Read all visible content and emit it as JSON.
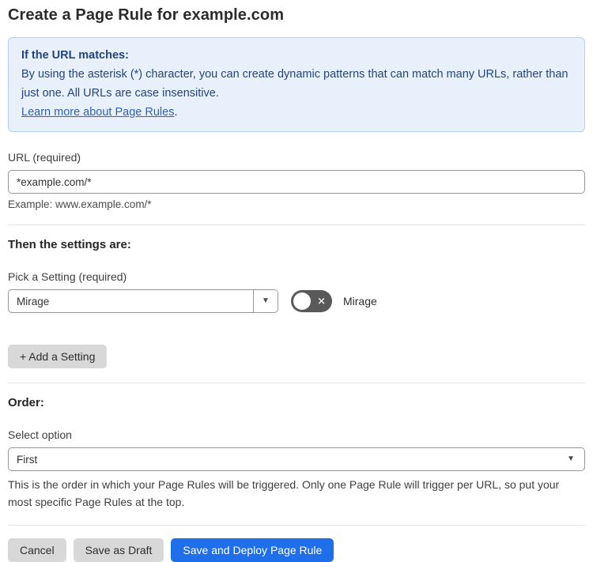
{
  "page": {
    "title": "Create a Page Rule for example.com"
  },
  "info_box": {
    "heading": "If the URL matches:",
    "body": "By using the asterisk (*) character, you can create dynamic patterns that can match many URLs, rather than just one. All URLs are case insensitive.",
    "link_label": "Learn more about Page Rules",
    "link_suffix": "."
  },
  "url_field": {
    "label": "URL (required)",
    "value": "*example.com/*",
    "helper": "Example: www.example.com/*"
  },
  "settings_section": {
    "heading": "Then the settings are:",
    "picker_label": "Pick a Setting (required)",
    "picker_value": "Mirage",
    "toggle_state": "off",
    "toggle_icon": "✕",
    "toggle_label": "Mirage",
    "add_setting_button": "+ Add a Setting"
  },
  "order_section": {
    "heading": "Order:",
    "select_label": "Select option",
    "select_value": "First",
    "helper": "This is the order in which your Page Rules will be triggered. Only one Page Rule will trigger per URL, so put your most specific Page Rules at the top."
  },
  "footer": {
    "cancel_label": "Cancel",
    "save_draft_label": "Save as Draft",
    "save_deploy_label": "Save and Deploy Page Rule"
  },
  "icons": {
    "dropdown_arrow": "▼"
  },
  "colors": {
    "info_bg": "#e8f1fb",
    "info_border": "#b4d0ee",
    "info_text": "#24457c",
    "link": "#2f62bd",
    "primary_button": "#1f6fea",
    "gray_button": "#d8d8d8",
    "toggle_off": "#595959",
    "divider": "#e4e4e4"
  }
}
